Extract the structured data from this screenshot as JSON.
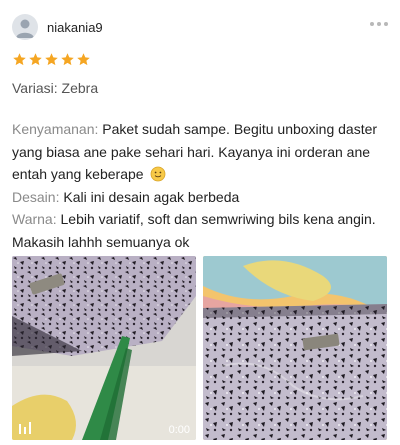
{
  "review": {
    "username": "niakania9",
    "rating": 5,
    "variant": "Variasi: Zebra",
    "lines": [
      {
        "label": "Kenyamanan:",
        "text": "Paket sudah sampe. Begitu unboxing daster yang biasa ane pake sehari hari. Kayanya ini orderan ane entah yang keberape",
        "emoji": "slightly-smiling-face-icon"
      },
      {
        "label": "Desain:",
        "text": "Kali ini desain agak berbeda"
      },
      {
        "label": "Warna:",
        "text": "Lebih variatif, soft dan semwriwing bils kena angin. Makasih lahhh semuanya ok"
      }
    ]
  },
  "media": [
    {
      "type": "video",
      "duration": "0:00"
    },
    {
      "type": "image"
    }
  ],
  "colors": {
    "star": "#f5a623",
    "label": "#8a8a8a",
    "avatar_bg": "#dfe3e8"
  }
}
